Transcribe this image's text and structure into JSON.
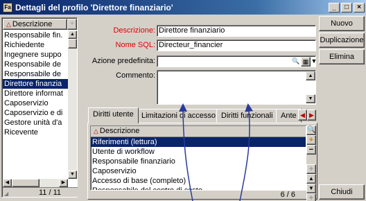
{
  "window": {
    "title": "Dettagli del profilo 'Direttore finanziario'",
    "app_icon_text": "Fa",
    "minimize": "_",
    "maximize": "□",
    "close": "×"
  },
  "left_list": {
    "header": "Descrizione",
    "plus": "+",
    "items": [
      {
        "label": "Responsabile fin.",
        "selected": false
      },
      {
        "label": "Richiedente",
        "selected": false
      },
      {
        "label": "Ingegnere suppo",
        "selected": false
      },
      {
        "label": "Responsabile de",
        "selected": false
      },
      {
        "label": "Responsabile de",
        "selected": false
      },
      {
        "label": "Direttore finanzia",
        "selected": true
      },
      {
        "label": "Direttore informat",
        "selected": false
      },
      {
        "label": "Caposervizio",
        "selected": false
      },
      {
        "label": "Caposervizio e di",
        "selected": false
      },
      {
        "label": "Gestore unità d'a",
        "selected": false
      },
      {
        "label": "Ricevente",
        "selected": false
      }
    ],
    "footer_count": "11 / 11"
  },
  "form": {
    "description_label": "Descrizione:",
    "description_value": "Direttore finanziario",
    "sql_name_label": "Nome SQL:",
    "sql_name_value": "Directeur_financier",
    "default_action_label": "Azione predefinita:",
    "default_action_value": "",
    "comment_label": "Commento:",
    "comment_value": ""
  },
  "buttons": {
    "new": "Nuovo",
    "duplicate": "Duplicazione",
    "delete": "Elimina",
    "close": "Chiudi"
  },
  "tabs": [
    {
      "label": "Diritti utente",
      "active": true
    },
    {
      "label": "Limitazioni di accesso",
      "active": false
    },
    {
      "label": "Diritti funzionali",
      "active": false
    },
    {
      "label": "Ante",
      "active": false
    }
  ],
  "rights_grid": {
    "header": "Descrizione",
    "rows": [
      {
        "label": "Riferimenti (lettura)",
        "selected": true
      },
      {
        "label": "Utente di workflow",
        "selected": false
      },
      {
        "label": "Responsabile finanziario",
        "selected": false
      },
      {
        "label": "Caposervizio",
        "selected": false
      },
      {
        "label": "Accesso di base (completo)",
        "selected": false
      },
      {
        "label": "Responsabile del centro di costo",
        "selected": false
      }
    ],
    "footer_count": "6 / 6"
  },
  "colors": {
    "selection": "#0a246a",
    "required_label": "#e00000",
    "window_face": "#d4d0c8",
    "arrow": "#2a3a9a"
  }
}
